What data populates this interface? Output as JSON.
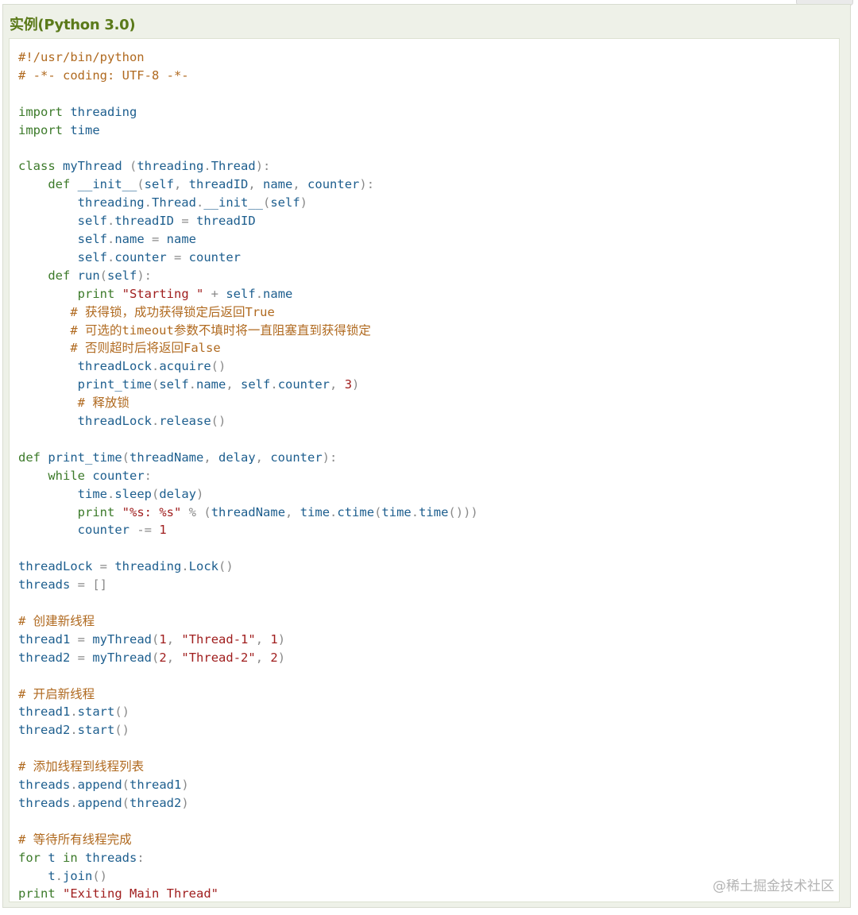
{
  "example": {
    "title": "实例(Python 3.0)"
  },
  "watermark": "@稀土掘金技术社区",
  "colors": {
    "comment": "#b06a20",
    "keyword": "#3c7a2a",
    "identifier": "#1d5e8e",
    "string": "#a01e1e",
    "punctuation": "#8a8a8a",
    "title": "#5b7a1a",
    "panel_background": "#eef1e8"
  },
  "code_lines": [
    [
      [
        "comment",
        "#!/usr/bin/python"
      ]
    ],
    [
      [
        "comment",
        "# -*- coding: UTF-8 -*-"
      ]
    ],
    [],
    [
      [
        "keyword",
        "import"
      ],
      [
        "plain",
        " threading"
      ]
    ],
    [
      [
        "keyword",
        "import"
      ],
      [
        "plain",
        " time"
      ]
    ],
    [],
    [
      [
        "keyword",
        "class"
      ],
      [
        "plain",
        " myThread "
      ],
      [
        "punct",
        "("
      ],
      [
        "plain",
        "threading"
      ],
      [
        "punct",
        "."
      ],
      [
        "plain",
        "Thread"
      ],
      [
        "punct",
        "):"
      ]
    ],
    [
      [
        "plain",
        "    "
      ],
      [
        "keyword",
        "def"
      ],
      [
        "plain",
        " __init__"
      ],
      [
        "punct",
        "("
      ],
      [
        "plain",
        "self"
      ],
      [
        "punct",
        ","
      ],
      [
        "plain",
        " threadID"
      ],
      [
        "punct",
        ","
      ],
      [
        "plain",
        " name"
      ],
      [
        "punct",
        ","
      ],
      [
        "plain",
        " counter"
      ],
      [
        "punct",
        "):"
      ]
    ],
    [
      [
        "plain",
        "        threading"
      ],
      [
        "punct",
        "."
      ],
      [
        "plain",
        "Thread"
      ],
      [
        "punct",
        "."
      ],
      [
        "plain",
        "__init__"
      ],
      [
        "punct",
        "("
      ],
      [
        "plain",
        "self"
      ],
      [
        "punct",
        ")"
      ]
    ],
    [
      [
        "plain",
        "        self"
      ],
      [
        "punct",
        "."
      ],
      [
        "plain",
        "threadID "
      ],
      [
        "punct",
        "="
      ],
      [
        "plain",
        " threadID"
      ]
    ],
    [
      [
        "plain",
        "        self"
      ],
      [
        "punct",
        "."
      ],
      [
        "plain",
        "name "
      ],
      [
        "punct",
        "="
      ],
      [
        "plain",
        " name"
      ]
    ],
    [
      [
        "plain",
        "        self"
      ],
      [
        "punct",
        "."
      ],
      [
        "plain",
        "counter "
      ],
      [
        "punct",
        "="
      ],
      [
        "plain",
        " counter"
      ]
    ],
    [
      [
        "plain",
        "    "
      ],
      [
        "keyword",
        "def"
      ],
      [
        "plain",
        " run"
      ],
      [
        "punct",
        "("
      ],
      [
        "plain",
        "self"
      ],
      [
        "punct",
        "):"
      ]
    ],
    [
      [
        "plain",
        "        "
      ],
      [
        "keyword",
        "print"
      ],
      [
        "plain",
        " "
      ],
      [
        "string",
        "\"Starting \""
      ],
      [
        "plain",
        " "
      ],
      [
        "punct",
        "+"
      ],
      [
        "plain",
        " self"
      ],
      [
        "punct",
        "."
      ],
      [
        "plain",
        "name"
      ]
    ],
    [
      [
        "plain",
        "       "
      ],
      [
        "comment",
        "# 获得锁，成功获得锁定后返回True"
      ]
    ],
    [
      [
        "plain",
        "       "
      ],
      [
        "comment",
        "# 可选的timeout参数不填时将一直阻塞直到获得锁定"
      ]
    ],
    [
      [
        "plain",
        "       "
      ],
      [
        "comment",
        "# 否则超时后将返回False"
      ]
    ],
    [
      [
        "plain",
        "        threadLock"
      ],
      [
        "punct",
        "."
      ],
      [
        "plain",
        "acquire"
      ],
      [
        "punct",
        "()"
      ]
    ],
    [
      [
        "plain",
        "        print_time"
      ],
      [
        "punct",
        "("
      ],
      [
        "plain",
        "self"
      ],
      [
        "punct",
        "."
      ],
      [
        "plain",
        "name"
      ],
      [
        "punct",
        ","
      ],
      [
        "plain",
        " self"
      ],
      [
        "punct",
        "."
      ],
      [
        "plain",
        "counter"
      ],
      [
        "punct",
        ","
      ],
      [
        "plain",
        " "
      ],
      [
        "number",
        "3"
      ],
      [
        "punct",
        ")"
      ]
    ],
    [
      [
        "plain",
        "        "
      ],
      [
        "comment",
        "# 释放锁"
      ]
    ],
    [
      [
        "plain",
        "        threadLock"
      ],
      [
        "punct",
        "."
      ],
      [
        "plain",
        "release"
      ],
      [
        "punct",
        "()"
      ]
    ],
    [],
    [
      [
        "keyword",
        "def"
      ],
      [
        "plain",
        " print_time"
      ],
      [
        "punct",
        "("
      ],
      [
        "plain",
        "threadName"
      ],
      [
        "punct",
        ","
      ],
      [
        "plain",
        " delay"
      ],
      [
        "punct",
        ","
      ],
      [
        "plain",
        " counter"
      ],
      [
        "punct",
        "):"
      ]
    ],
    [
      [
        "plain",
        "    "
      ],
      [
        "keyword",
        "while"
      ],
      [
        "plain",
        " counter"
      ],
      [
        "punct",
        ":"
      ]
    ],
    [
      [
        "plain",
        "        time"
      ],
      [
        "punct",
        "."
      ],
      [
        "plain",
        "sleep"
      ],
      [
        "punct",
        "("
      ],
      [
        "plain",
        "delay"
      ],
      [
        "punct",
        ")"
      ]
    ],
    [
      [
        "plain",
        "        "
      ],
      [
        "keyword",
        "print"
      ],
      [
        "plain",
        " "
      ],
      [
        "string",
        "\"%s: %s\""
      ],
      [
        "plain",
        " "
      ],
      [
        "punct",
        "%"
      ],
      [
        "plain",
        " "
      ],
      [
        "punct",
        "("
      ],
      [
        "plain",
        "threadName"
      ],
      [
        "punct",
        ","
      ],
      [
        "plain",
        " time"
      ],
      [
        "punct",
        "."
      ],
      [
        "plain",
        "ctime"
      ],
      [
        "punct",
        "("
      ],
      [
        "plain",
        "time"
      ],
      [
        "punct",
        "."
      ],
      [
        "plain",
        "time"
      ],
      [
        "punct",
        "()))"
      ]
    ],
    [
      [
        "plain",
        "        counter "
      ],
      [
        "punct",
        "-="
      ],
      [
        "plain",
        " "
      ],
      [
        "number",
        "1"
      ]
    ],
    [],
    [
      [
        "plain",
        "threadLock "
      ],
      [
        "punct",
        "="
      ],
      [
        "plain",
        " threading"
      ],
      [
        "punct",
        "."
      ],
      [
        "plain",
        "Lock"
      ],
      [
        "punct",
        "()"
      ]
    ],
    [
      [
        "plain",
        "threads "
      ],
      [
        "punct",
        "="
      ],
      [
        "plain",
        " "
      ],
      [
        "punct",
        "[]"
      ]
    ],
    [],
    [
      [
        "comment",
        "# 创建新线程"
      ]
    ],
    [
      [
        "plain",
        "thread1 "
      ],
      [
        "punct",
        "="
      ],
      [
        "plain",
        " myThread"
      ],
      [
        "punct",
        "("
      ],
      [
        "number",
        "1"
      ],
      [
        "punct",
        ","
      ],
      [
        "plain",
        " "
      ],
      [
        "string",
        "\"Thread-1\""
      ],
      [
        "punct",
        ","
      ],
      [
        "plain",
        " "
      ],
      [
        "number",
        "1"
      ],
      [
        "punct",
        ")"
      ]
    ],
    [
      [
        "plain",
        "thread2 "
      ],
      [
        "punct",
        "="
      ],
      [
        "plain",
        " myThread"
      ],
      [
        "punct",
        "("
      ],
      [
        "number",
        "2"
      ],
      [
        "punct",
        ","
      ],
      [
        "plain",
        " "
      ],
      [
        "string",
        "\"Thread-2\""
      ],
      [
        "punct",
        ","
      ],
      [
        "plain",
        " "
      ],
      [
        "number",
        "2"
      ],
      [
        "punct",
        ")"
      ]
    ],
    [],
    [
      [
        "comment",
        "# 开启新线程"
      ]
    ],
    [
      [
        "plain",
        "thread1"
      ],
      [
        "punct",
        "."
      ],
      [
        "plain",
        "start"
      ],
      [
        "punct",
        "()"
      ]
    ],
    [
      [
        "plain",
        "thread2"
      ],
      [
        "punct",
        "."
      ],
      [
        "plain",
        "start"
      ],
      [
        "punct",
        "()"
      ]
    ],
    [],
    [
      [
        "comment",
        "# 添加线程到线程列表"
      ]
    ],
    [
      [
        "plain",
        "threads"
      ],
      [
        "punct",
        "."
      ],
      [
        "plain",
        "append"
      ],
      [
        "punct",
        "("
      ],
      [
        "plain",
        "thread1"
      ],
      [
        "punct",
        ")"
      ]
    ],
    [
      [
        "plain",
        "threads"
      ],
      [
        "punct",
        "."
      ],
      [
        "plain",
        "append"
      ],
      [
        "punct",
        "("
      ],
      [
        "plain",
        "thread2"
      ],
      [
        "punct",
        ")"
      ]
    ],
    [],
    [
      [
        "comment",
        "# 等待所有线程完成"
      ]
    ],
    [
      [
        "keyword",
        "for"
      ],
      [
        "plain",
        " t "
      ],
      [
        "keyword",
        "in"
      ],
      [
        "plain",
        " threads"
      ],
      [
        "punct",
        ":"
      ]
    ],
    [
      [
        "plain",
        "    t"
      ],
      [
        "punct",
        "."
      ],
      [
        "plain",
        "join"
      ],
      [
        "punct",
        "()"
      ]
    ],
    [
      [
        "keyword",
        "print"
      ],
      [
        "plain",
        " "
      ],
      [
        "string",
        "\"Exiting Main Thread\""
      ]
    ]
  ]
}
